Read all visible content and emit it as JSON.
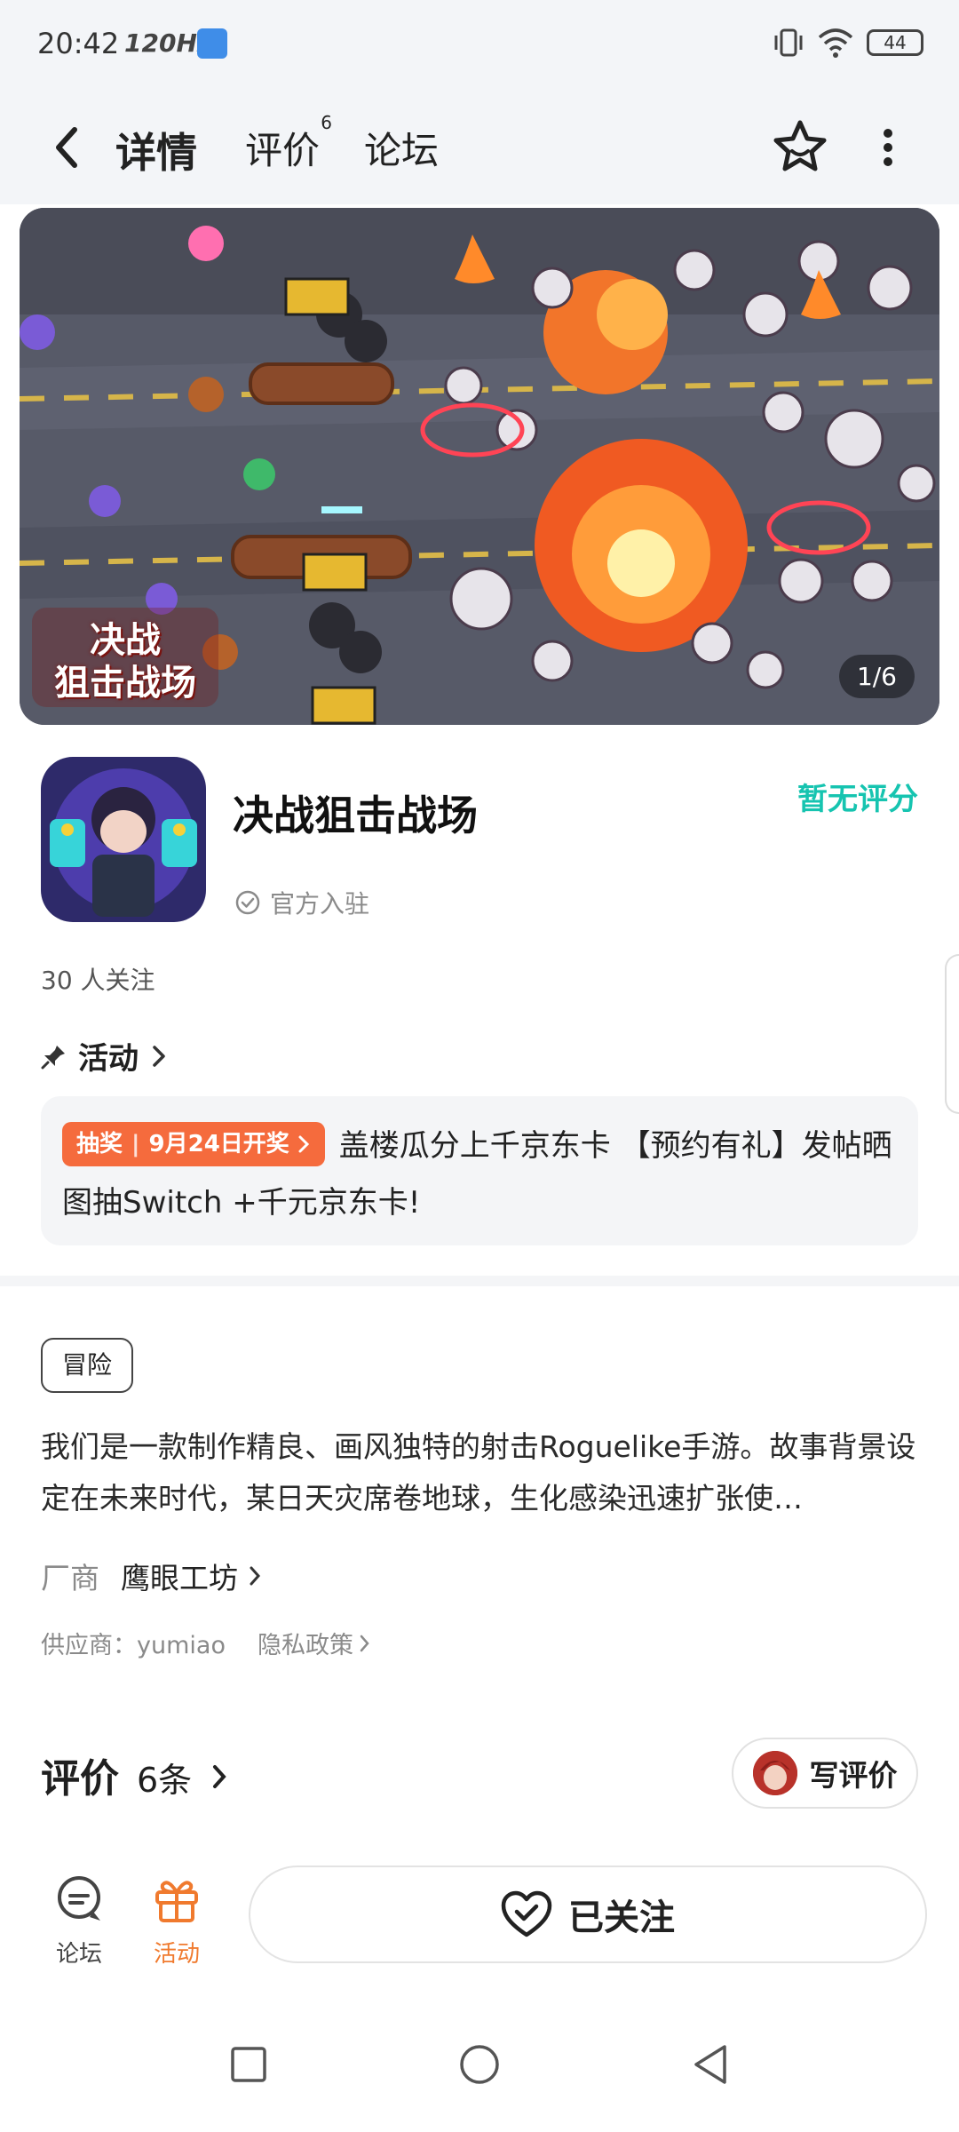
{
  "status_bar": {
    "time": "20:42",
    "refresh": "120Hz",
    "battery": "44"
  },
  "header": {
    "tabs": [
      {
        "label": "详情"
      },
      {
        "label": "评价",
        "badge": "6"
      },
      {
        "label": "论坛"
      }
    ]
  },
  "banner": {
    "logo_text": "决战\n狙击战场",
    "counter": "1/6"
  },
  "app": {
    "name": "决战狙击战场",
    "rating": "暂无评分",
    "official": "官方入驻",
    "followers": "30 人关注"
  },
  "activity": {
    "heading": "活动",
    "tag": "抽奖",
    "tag_date": "9月24日开奖",
    "text": "盖楼瓜分上千京东卡 【预约有礼】发帖晒图抽Switch +千元京东卡!"
  },
  "details": {
    "genre": "冒险",
    "description": "我们是一款制作精良、画风独特的射击Roguelike手游。故事背景设定在未来时代，某日天灾席卷地球，生化感染迅速扩张使…",
    "vendor_label": "厂商",
    "vendor_name": "鹰眼工坊",
    "supplier": "供应商：yumiao",
    "privacy": "隐私政策"
  },
  "reviews": {
    "title": "评价",
    "count": "6条",
    "write_label": "写评价"
  },
  "bottom_bar": {
    "forum_label": "论坛",
    "activity_label": "活动",
    "follow_label": "已关注"
  },
  "colors": {
    "accent": "#16c4b0",
    "orange": "#f56b3d",
    "activity_orange": "#f07a2e"
  }
}
